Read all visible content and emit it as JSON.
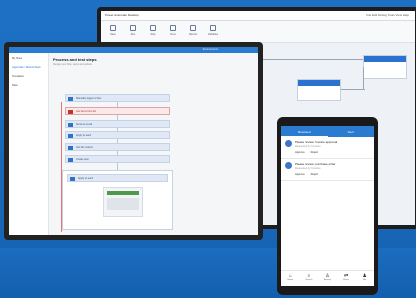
{
  "back_window": {
    "title": "Power Automate Desktop",
    "right_menu": "File  Edit  Debug  Tools  View  Help",
    "ribbon": [
      "Save",
      "Run",
      "Stop",
      "Next",
      "Record",
      "Variables"
    ]
  },
  "laptop": {
    "top_text": "Environments",
    "sidebar": [
      "My flows",
      "Approvals / Recent flows",
      "Templates",
      "Data"
    ],
    "heading": "Process and test steps",
    "subheading": "Design your flow, steps and actions",
    "steps": [
      "Manually trigger a flow",
      "Get items from list",
      "Send an email",
      "Apply to each",
      "Get file content",
      "Create item",
      "Apply to each"
    ]
  },
  "phone": {
    "tabs": [
      "Received",
      "Sent"
    ],
    "cards": [
      {
        "title": "Please review: Invoice approval",
        "sub": "Requested by Contoso",
        "approve": "Approve",
        "reject": "Reject"
      },
      {
        "title": "Please review: purchase order",
        "sub": "Requested by Contoso",
        "approve": "Approve",
        "reject": "Reject"
      }
    ],
    "nav": [
      "Home",
      "Search",
      "Activity",
      "Flows",
      "Me"
    ]
  }
}
